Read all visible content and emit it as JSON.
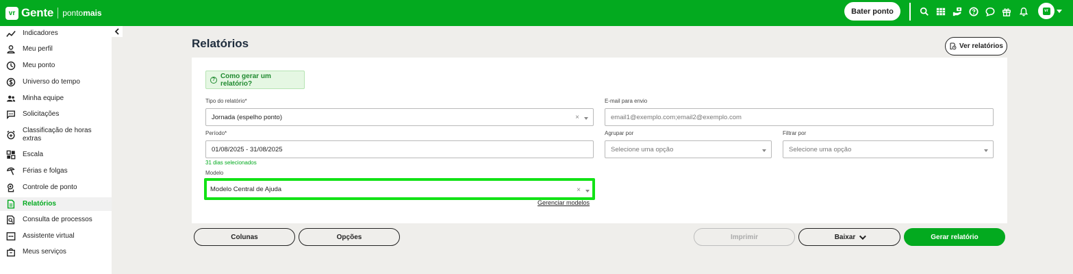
{
  "app": {
    "brand": "Gente",
    "logo_badge": "vr",
    "subbrand_a": "ponto",
    "subbrand_b": "mais",
    "punch_button": "Bater ponto",
    "accent_color": "#03aa1f",
    "top_icons": [
      "search-icon",
      "grid-icon",
      "hand-money-icon",
      "help-icon",
      "chat-icon",
      "gift-icon",
      "bell-icon"
    ]
  },
  "sidebar": {
    "items": [
      {
        "label": "Indicadores",
        "icon": "trend-icon"
      },
      {
        "label": "Meu perfil",
        "icon": "person-icon"
      },
      {
        "label": "Meu ponto",
        "icon": "clock-icon"
      },
      {
        "label": "Universo do tempo",
        "icon": "dollar-icon"
      },
      {
        "label": "Minha equipe",
        "icon": "team-icon"
      },
      {
        "label": "Solicitações",
        "icon": "message-icon"
      },
      {
        "label": "Classificação de horas extras",
        "icon": "alarm-plus-icon"
      },
      {
        "label": "Escala",
        "icon": "schedule-grid-icon"
      },
      {
        "label": "Férias e folgas",
        "icon": "beach-icon"
      },
      {
        "label": "Controle de ponto",
        "icon": "fingerprint-icon"
      },
      {
        "label": "Relatórios",
        "icon": "document-icon",
        "active": true
      },
      {
        "label": "Consulta de processos",
        "icon": "doc-search-icon"
      },
      {
        "label": "Assistente virtual",
        "icon": "assistant-icon"
      },
      {
        "label": "Meus serviços",
        "icon": "bag-icon"
      }
    ]
  },
  "page": {
    "title": "Relatórios",
    "view_reports_button": "Ver relatórios",
    "help_link": "Como gerar um relatório?",
    "help_glyph": "?"
  },
  "form": {
    "report_type": {
      "label": "Tipo do relatório*",
      "value": "Jornada (espelho ponto)"
    },
    "email": {
      "label": "E-mail para envio",
      "placeholder": "email1@exemplo.com;email2@exemplo.com"
    },
    "period": {
      "label": "Período*",
      "value": "01/08/2025 - 31/08/2025",
      "hint": "31 dias selecionados"
    },
    "group_by": {
      "label": "Agrupar por",
      "placeholder": "Selecione uma opção"
    },
    "filter_by": {
      "label": "Filtrar por",
      "placeholder": "Selecione uma opção"
    },
    "model": {
      "label": "Modelo",
      "value": "Modelo Central de Ajuda",
      "manage_link": "Gerenciar modelos"
    },
    "clear_glyph": "×"
  },
  "actions": {
    "columns": "Colunas",
    "options": "Opções",
    "print": "Imprimir",
    "download": "Baixar",
    "generate": "Gerar relatório"
  }
}
